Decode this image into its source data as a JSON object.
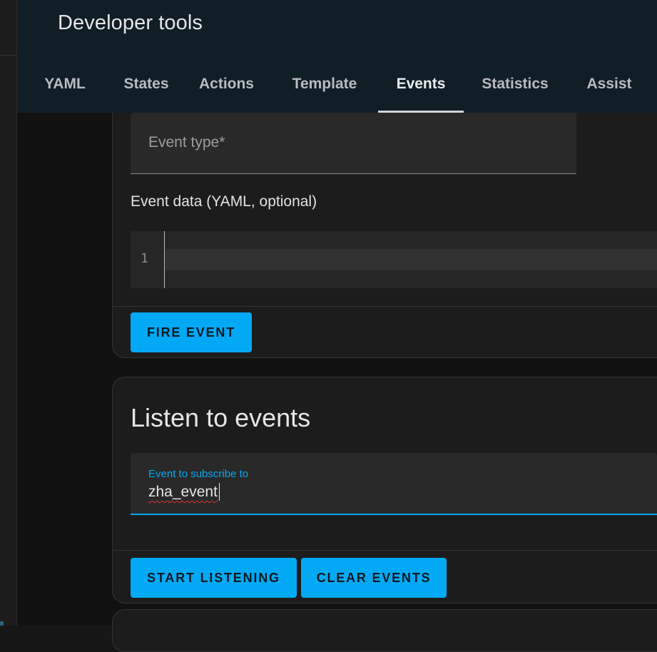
{
  "header": {
    "title": "Developer tools"
  },
  "tabs": [
    {
      "label": "YAML",
      "active": false
    },
    {
      "label": "States",
      "active": false
    },
    {
      "label": "Actions",
      "active": false
    },
    {
      "label": "Template",
      "active": false
    },
    {
      "label": "Events",
      "active": true
    },
    {
      "label": "Statistics",
      "active": false
    },
    {
      "label": "Assist",
      "active": false
    }
  ],
  "fire_event": {
    "event_type_placeholder": "Event type*",
    "event_data_label": "Event data (YAML, optional)",
    "editor_line_number": "1",
    "fire_button": "FIRE EVENT"
  },
  "listen": {
    "title": "Listen to events",
    "subscribe_label": "Event to subscribe to",
    "subscribe_value": "zha_event",
    "start_button": "START LISTENING",
    "clear_button": "CLEAR EVENTS"
  },
  "colors": {
    "accent": "#03a9f4",
    "header_bg": "#101e26",
    "card_bg": "#1c1c1c"
  }
}
